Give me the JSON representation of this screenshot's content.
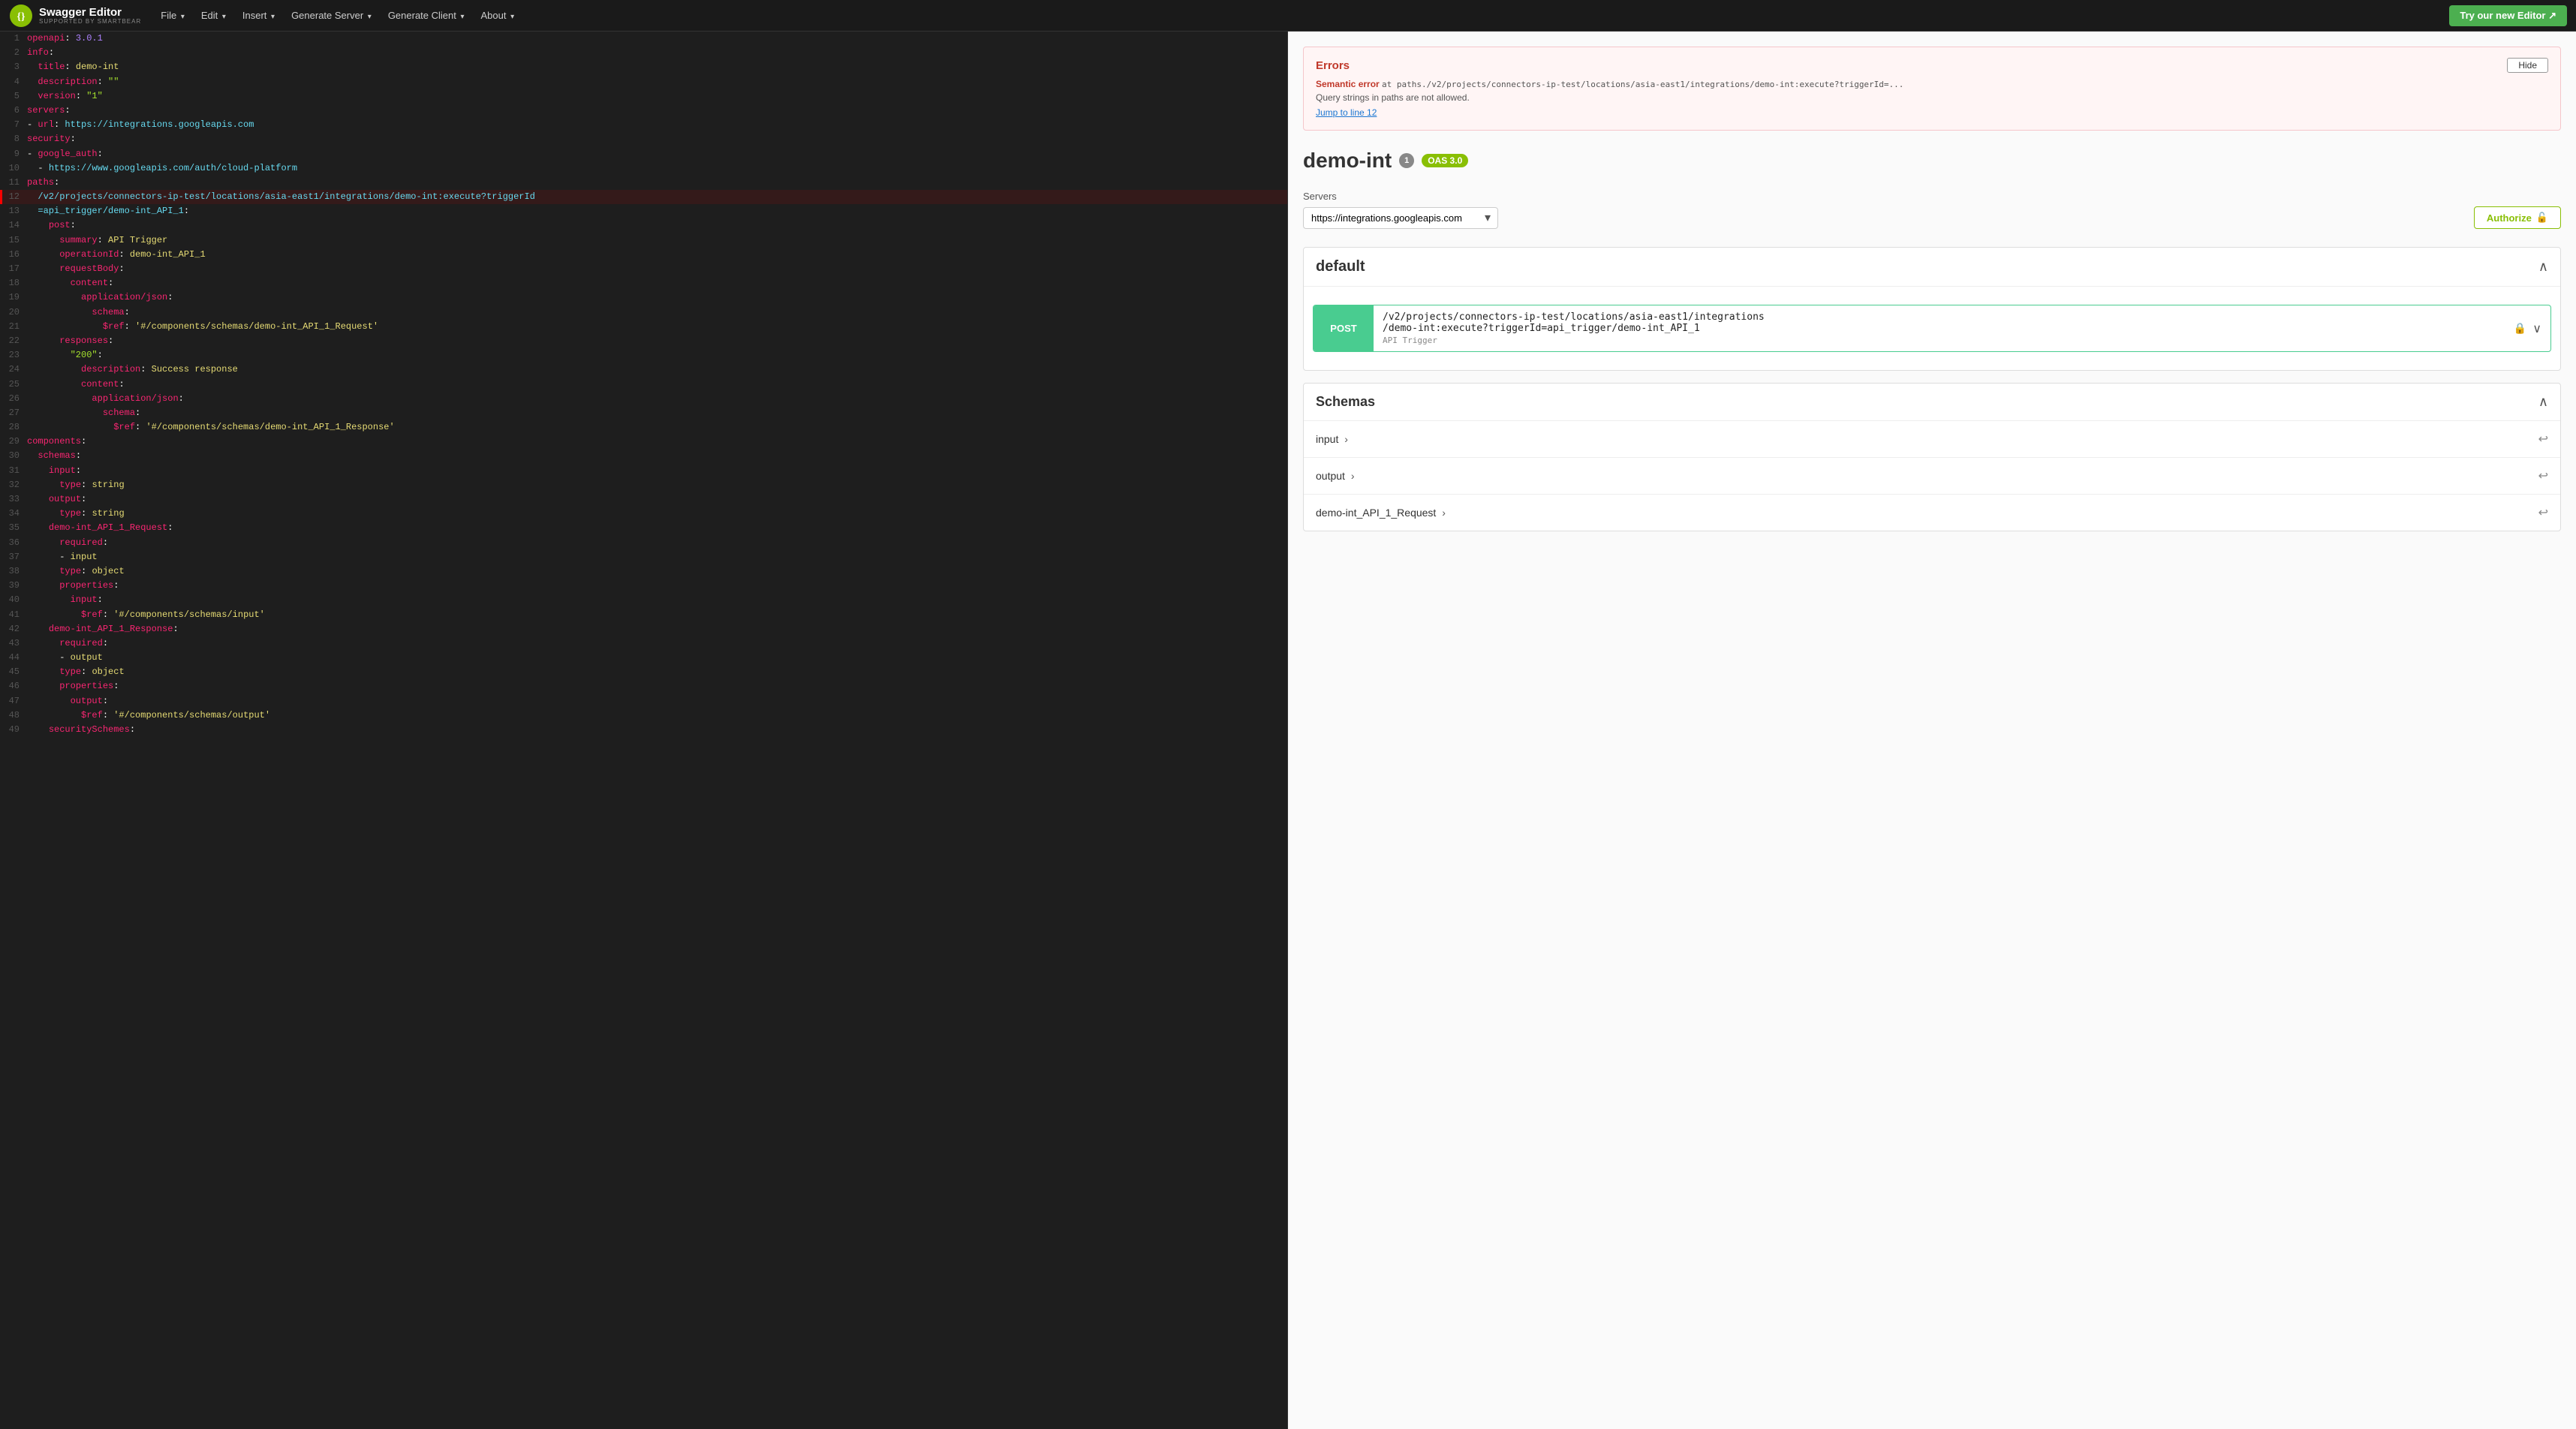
{
  "navbar": {
    "logo_main": "Swagger Editor",
    "logo_sub": "SUPPORTED BY SMARTBEAR",
    "menu_items": [
      "File",
      "Edit",
      "Insert",
      "Generate Server",
      "Generate Client",
      "About"
    ],
    "try_editor_btn": "Try our new Editor ↗"
  },
  "editor": {
    "lines": [
      {
        "num": 1,
        "text": "openapi: 3.0.1",
        "classes": ""
      },
      {
        "num": 2,
        "text": "info:",
        "classes": ""
      },
      {
        "num": 3,
        "text": "  title: demo-int",
        "classes": ""
      },
      {
        "num": 4,
        "text": "  description: \"\"",
        "classes": ""
      },
      {
        "num": 5,
        "text": "  version: \"1\"",
        "classes": ""
      },
      {
        "num": 6,
        "text": "servers:",
        "classes": ""
      },
      {
        "num": 7,
        "text": "- url: https://integrations.googleapis.com",
        "classes": ""
      },
      {
        "num": 8,
        "text": "security:",
        "classes": ""
      },
      {
        "num": 9,
        "text": "- google_auth:",
        "classes": ""
      },
      {
        "num": 10,
        "text": "  - https://www.googleapis.com/auth/cloud-platform",
        "classes": ""
      },
      {
        "num": 11,
        "text": "paths:",
        "classes": ""
      },
      {
        "num": 12,
        "text": "  /v2/projects/connectors-ip-test/locations/asia-east1/integrations/demo-int:execute?triggerId",
        "classes": "error"
      },
      {
        "num": 13,
        "text": "  =api_trigger/demo-int_API_1:",
        "classes": ""
      },
      {
        "num": 14,
        "text": "    post:",
        "classes": ""
      },
      {
        "num": 15,
        "text": "      summary: API Trigger",
        "classes": ""
      },
      {
        "num": 16,
        "text": "      operationId: demo-int_API_1",
        "classes": ""
      },
      {
        "num": 17,
        "text": "      requestBody:",
        "classes": ""
      },
      {
        "num": 18,
        "text": "        content:",
        "classes": ""
      },
      {
        "num": 19,
        "text": "          application/json:",
        "classes": ""
      },
      {
        "num": 20,
        "text": "            schema:",
        "classes": ""
      },
      {
        "num": 21,
        "text": "              $ref: '#/components/schemas/demo-int_API_1_Request'",
        "classes": ""
      },
      {
        "num": 22,
        "text": "      responses:",
        "classes": ""
      },
      {
        "num": 23,
        "text": "        \"200\":",
        "classes": ""
      },
      {
        "num": 24,
        "text": "          description: Success response",
        "classes": ""
      },
      {
        "num": 25,
        "text": "          content:",
        "classes": ""
      },
      {
        "num": 26,
        "text": "            application/json:",
        "classes": ""
      },
      {
        "num": 27,
        "text": "              schema:",
        "classes": ""
      },
      {
        "num": 28,
        "text": "                $ref: '#/components/schemas/demo-int_API_1_Response'",
        "classes": ""
      },
      {
        "num": 29,
        "text": "components:",
        "classes": ""
      },
      {
        "num": 30,
        "text": "  schemas:",
        "classes": ""
      },
      {
        "num": 31,
        "text": "    input:",
        "classes": ""
      },
      {
        "num": 32,
        "text": "      type: string",
        "classes": ""
      },
      {
        "num": 33,
        "text": "    output:",
        "classes": ""
      },
      {
        "num": 34,
        "text": "      type: string",
        "classes": ""
      },
      {
        "num": 35,
        "text": "    demo-int_API_1_Request:",
        "classes": ""
      },
      {
        "num": 36,
        "text": "      required:",
        "classes": ""
      },
      {
        "num": 37,
        "text": "      - input",
        "classes": ""
      },
      {
        "num": 38,
        "text": "      type: object",
        "classes": ""
      },
      {
        "num": 39,
        "text": "      properties:",
        "classes": ""
      },
      {
        "num": 40,
        "text": "        input:",
        "classes": ""
      },
      {
        "num": 41,
        "text": "          $ref: '#/components/schemas/input'",
        "classes": ""
      },
      {
        "num": 42,
        "text": "    demo-int_API_1_Response:",
        "classes": ""
      },
      {
        "num": 43,
        "text": "      required:",
        "classes": ""
      },
      {
        "num": 44,
        "text": "      - output",
        "classes": ""
      },
      {
        "num": 45,
        "text": "      type: object",
        "classes": ""
      },
      {
        "num": 46,
        "text": "      properties:",
        "classes": ""
      },
      {
        "num": 47,
        "text": "        output:",
        "classes": ""
      },
      {
        "num": 48,
        "text": "          $ref: '#/components/schemas/output'",
        "classes": ""
      },
      {
        "num": 49,
        "text": "    securitySchemes:",
        "classes": ""
      }
    ]
  },
  "preview": {
    "errors": {
      "title": "Errors",
      "hide_btn": "Hide",
      "semantic_label": "Semantic error",
      "path": "at paths./v2/projects/connectors-ip-test/locations/asia-east1/integrations/demo-int:execute?triggerId=...",
      "message": "Query strings in paths are not allowed.",
      "jump_link": "Jump to line 12"
    },
    "api_title": "demo-int",
    "badge_num": "1",
    "badge_oas": "OAS 3.0",
    "servers_label": "Servers",
    "server_url": "https://integrations.googleapis.com",
    "authorize_btn": "Authorize",
    "default_section": {
      "title": "default",
      "endpoint": {
        "method": "POST",
        "path_line1": "/v2/projects/connectors-ip-test/locations/asia-east1/integrations",
        "path_line2": "/demo-int:execute?triggerId=api_trigger/demo-int_API_1",
        "summary": "API Trigger"
      }
    },
    "schemas_section": {
      "title": "Schemas",
      "items": [
        {
          "name": "input",
          "arrow": "›"
        },
        {
          "name": "output",
          "arrow": "›"
        },
        {
          "name": "demo-int_API_1_Request",
          "arrow": "›"
        }
      ]
    }
  }
}
